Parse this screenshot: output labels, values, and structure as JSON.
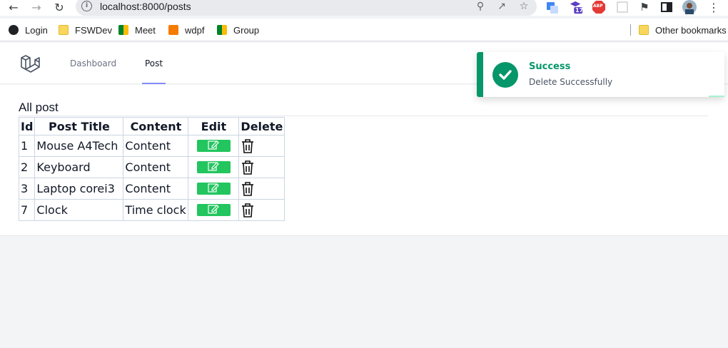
{
  "browser": {
    "url": "localhost:8000/posts",
    "bookmarks": [
      {
        "label": "Login"
      },
      {
        "label": "FSWDev"
      },
      {
        "label": "Meet"
      },
      {
        "label": "wdpf"
      },
      {
        "label": "Group"
      }
    ],
    "other_bookmarks": "Other bookmarks",
    "ext_badge": "17",
    "abp_label": "ABP"
  },
  "nav": {
    "links": [
      {
        "label": "Dashboard",
        "active": false
      },
      {
        "label": "Post",
        "active": true
      }
    ]
  },
  "toast": {
    "title": "Success",
    "message": "Delete Successfully",
    "accent": "#059669"
  },
  "page": {
    "heading": "All post"
  },
  "table": {
    "headers": [
      "Id",
      "Post Title",
      "Content",
      "Edit",
      "Delete"
    ],
    "rows": [
      {
        "id": "1",
        "title": "Mouse A4Tech",
        "content": "Content"
      },
      {
        "id": "2",
        "title": "Keyboard",
        "content": "Content"
      },
      {
        "id": "3",
        "title": "Laptop corei3",
        "content": "Content"
      },
      {
        "id": "7",
        "title": "Clock",
        "content": "Time clock"
      }
    ],
    "edit_color": "#22c55e"
  }
}
